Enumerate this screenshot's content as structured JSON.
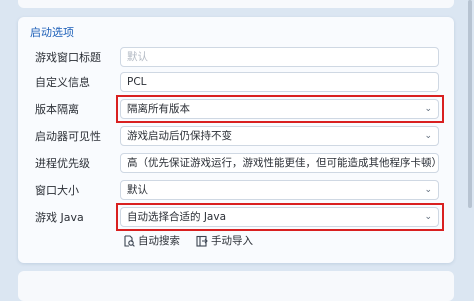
{
  "section": {
    "title": "启动选项"
  },
  "rows": [
    {
      "label": "游戏窗口标题",
      "value": "",
      "placeholder": "默认"
    },
    {
      "label": "自定义信息",
      "value": "PCL",
      "placeholder": ""
    },
    {
      "label": "版本隔离",
      "value": "隔离所有版本",
      "dropdown": true
    },
    {
      "label": "启动器可见性",
      "value": "游戏启动后仍保持不变",
      "dropdown": true
    },
    {
      "label": "进程优先级",
      "value": "高（优先保证游戏运行，游戏性能更佳，但可能造成其他程序卡顿）",
      "dropdown": true
    },
    {
      "label": "窗口大小",
      "value": "默认",
      "dropdown": true
    },
    {
      "label": "游戏 Java",
      "value": "自动选择合适的 Java",
      "dropdown": true
    }
  ],
  "buttons": {
    "auto_search": "自动搜索",
    "manual_import": "手动导入"
  },
  "icons": {
    "auto_search": "document-search-icon",
    "manual_import": "folder-import-icon",
    "dropdown": "chevron-down-icon"
  },
  "colors": {
    "accent": "#1d5fb8",
    "highlight": "#d92020",
    "background": "#dbe6f2"
  }
}
